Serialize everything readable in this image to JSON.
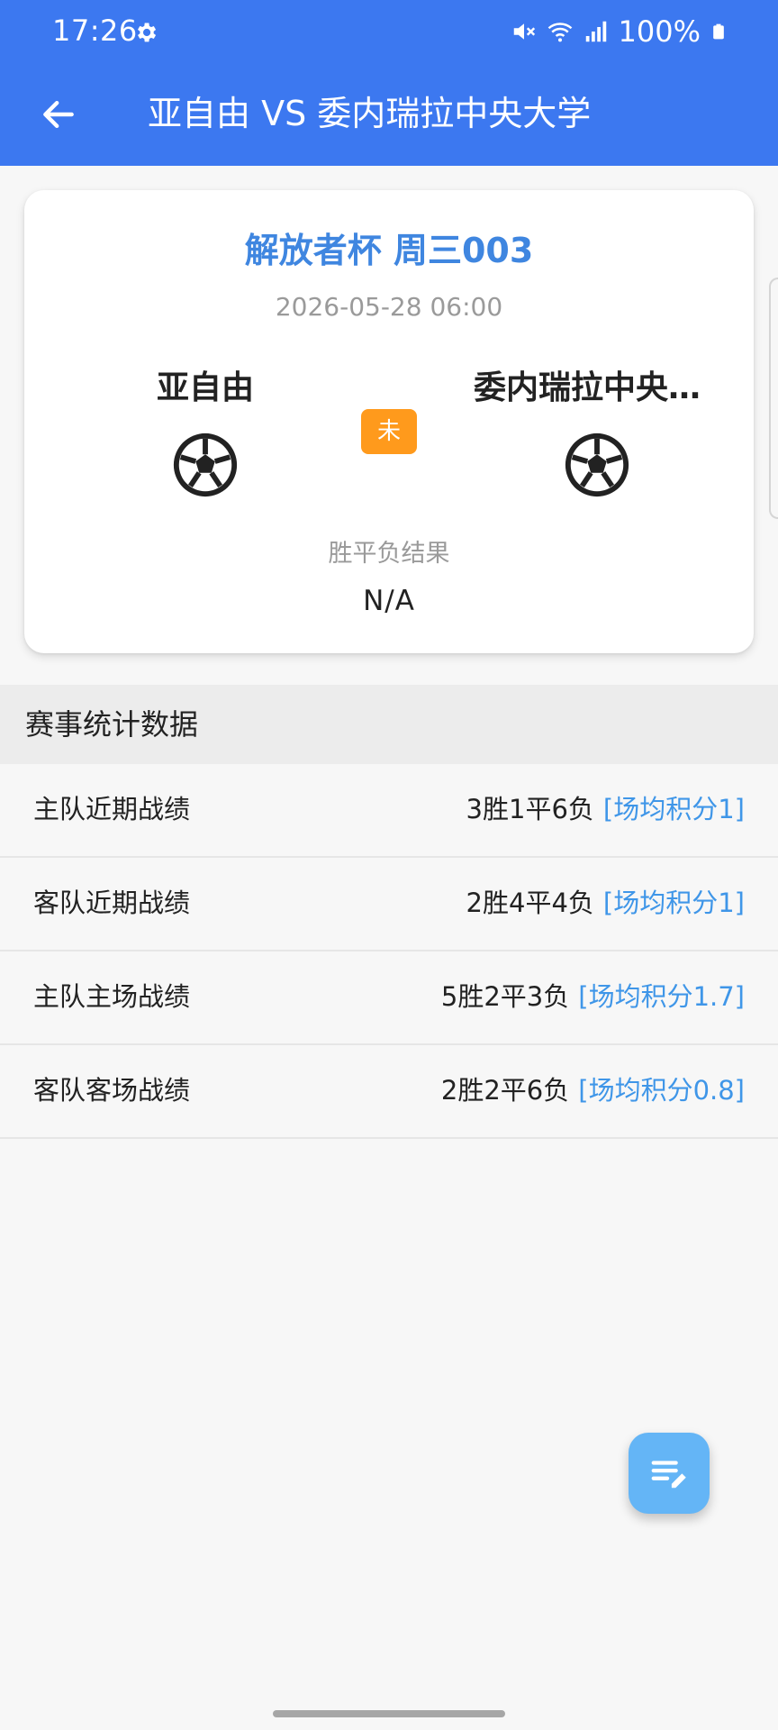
{
  "status_bar": {
    "time": "17:26",
    "battery": "100%",
    "icons": [
      "gear-icon",
      "mute-icon",
      "wifi-icon",
      "signal-icon",
      "battery-icon"
    ]
  },
  "header": {
    "title": "亚自由 VS 委内瑞拉中央大学",
    "background_color": "#3c78f0",
    "back_icon": "arrow-left-icon"
  },
  "match": {
    "cup": "解放者杯 周三003",
    "datetime": "2026-05-28 06:00",
    "home_team": "亚自由",
    "away_team": "委内瑞拉中央…",
    "status_tag": "未",
    "status_tag_color": "#ff9a1c",
    "result_label": "胜平负结果",
    "result_value": "N/A",
    "team_icon": "soccer-ball-icon"
  },
  "stats": {
    "title": "赛事统计数据",
    "rows": [
      {
        "label": "主队近期战绩",
        "record": "3胜1平6负",
        "avg": "[场均积分1]"
      },
      {
        "label": "客队近期战绩",
        "record": "2胜4平4负",
        "avg": "[场均积分1]"
      },
      {
        "label": "主队主场战绩",
        "record": "5胜2平3负",
        "avg": "[场均积分1.7]"
      },
      {
        "label": "客队客场战绩",
        "record": "2胜2平6负",
        "avg": "[场均积分0.8]"
      }
    ],
    "accent_color": "#3f96e8"
  },
  "fab": {
    "icon": "edit-note-icon",
    "color": "#64b5f6"
  }
}
